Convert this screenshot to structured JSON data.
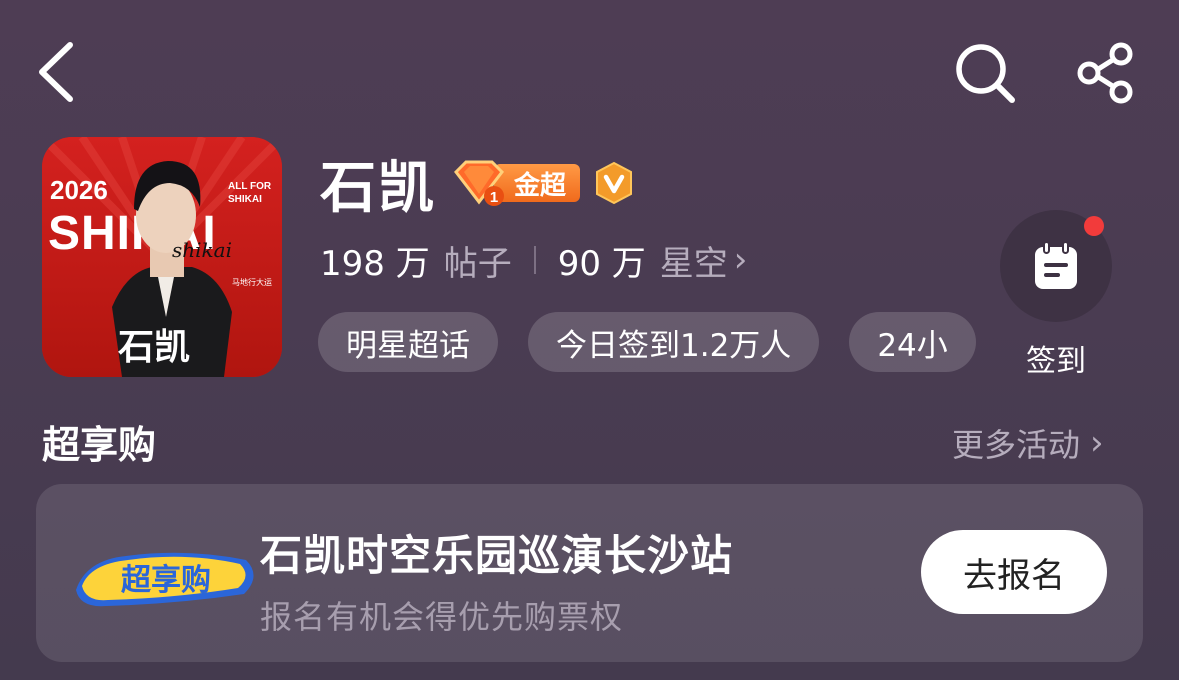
{
  "topbar": {
    "back_icon": "chevron-left-icon",
    "search_icon": "search-icon",
    "share_icon": "share-icon"
  },
  "topic": {
    "name": "石凯",
    "gold_label": "金超",
    "gem_level": "1",
    "verified_icon": "v-verified-icon",
    "avatar_text": {
      "year": "2026",
      "big": "SHIKAI",
      "all_for": "ALL FOR",
      "shikai": "SHIKAI",
      "subtitle": "马地行大运",
      "name": "石凯",
      "signature": "shikai"
    }
  },
  "stats": {
    "posts_num": "198 万",
    "posts_label": "帖子",
    "fans_num": "90 万",
    "fans_label": "星空",
    "chevron": "›"
  },
  "tags": [
    "明星超话",
    "今日签到1.2万人",
    "24小"
  ],
  "checkin": {
    "label": "签到",
    "icon": "calendar-icon"
  },
  "section": {
    "title": "超享购",
    "more": "更多活动",
    "more_chevron": "›"
  },
  "promo": {
    "logo_text": "超享购",
    "title": "石凯时空乐园巡演长沙站",
    "subtitle": "报名有机会得优先购票权",
    "button": "去报名"
  },
  "colors": {
    "background": "#4b3d52",
    "gold_badge": "#f27a22",
    "red_dot": "#f23b3b",
    "muted_text": "#b6adbd"
  }
}
